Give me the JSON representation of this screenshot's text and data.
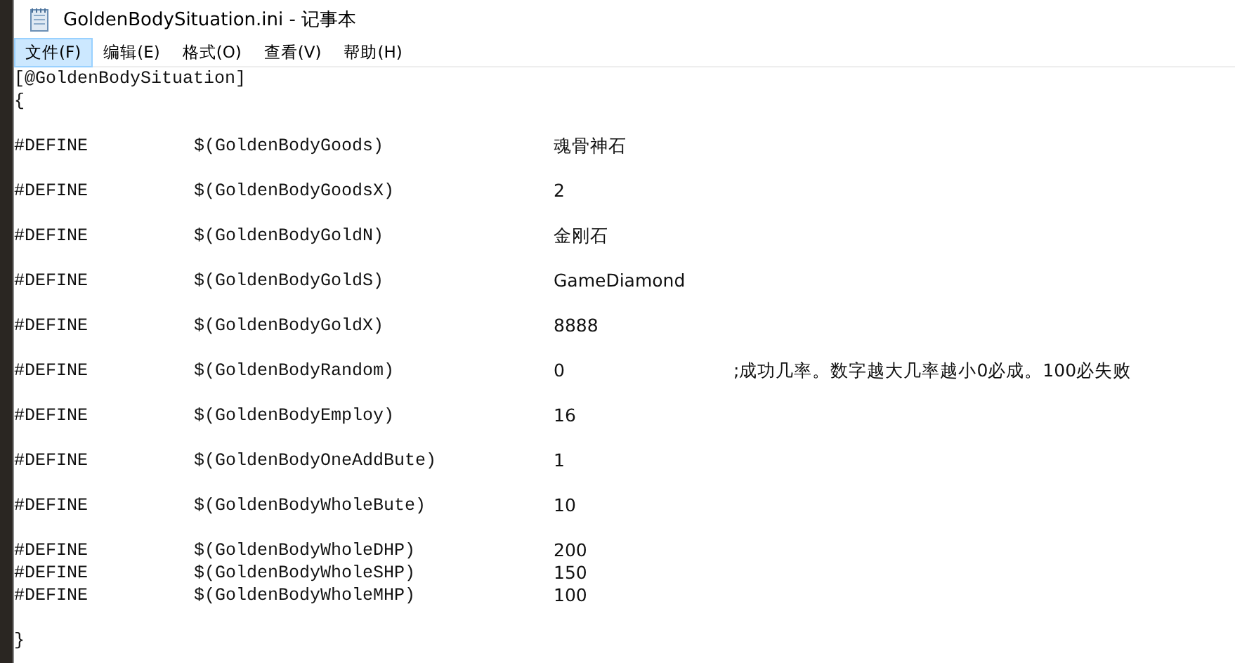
{
  "window": {
    "title": "GoldenBodySituation.ini - 记事本"
  },
  "menu": [
    {
      "label": "文件(F)",
      "selected": true
    },
    {
      "label": "编辑(E)",
      "selected": false
    },
    {
      "label": "格式(O)",
      "selected": false
    },
    {
      "label": "查看(V)",
      "selected": false
    },
    {
      "label": "帮助(H)",
      "selected": false
    }
  ],
  "lines": [
    {
      "kind": "text",
      "text": "[@GoldenBodySituation]"
    },
    {
      "kind": "text",
      "text": "{"
    },
    {
      "kind": "blank"
    },
    {
      "kind": "define",
      "keyword": "#DEFINE",
      "name": "$(GoldenBodyGoods)",
      "value": "魂骨神石"
    },
    {
      "kind": "blank"
    },
    {
      "kind": "define",
      "keyword": "#DEFINE",
      "name": "$(GoldenBodyGoodsX)",
      "value": "2"
    },
    {
      "kind": "blank"
    },
    {
      "kind": "define",
      "keyword": "#DEFINE",
      "name": "$(GoldenBodyGoldN)",
      "value": "金刚石"
    },
    {
      "kind": "blank"
    },
    {
      "kind": "define",
      "keyword": "#DEFINE",
      "name": "$(GoldenBodyGoldS)",
      "value": "GameDiamond"
    },
    {
      "kind": "blank"
    },
    {
      "kind": "define",
      "keyword": "#DEFINE",
      "name": "$(GoldenBodyGoldX)",
      "value": "8888"
    },
    {
      "kind": "blank"
    },
    {
      "kind": "define",
      "keyword": "#DEFINE",
      "name": "$(GoldenBodyRandom)",
      "value": "0",
      "comment": ";成功几率。数字越大几率越小0必成。100必失败"
    },
    {
      "kind": "blank"
    },
    {
      "kind": "define",
      "keyword": "#DEFINE",
      "name": "$(GoldenBodyEmploy)",
      "value": "16"
    },
    {
      "kind": "blank"
    },
    {
      "kind": "define",
      "keyword": "#DEFINE",
      "name": "$(GoldenBodyOneAddBute)",
      "value": "1"
    },
    {
      "kind": "blank"
    },
    {
      "kind": "define",
      "keyword": "#DEFINE",
      "name": "$(GoldenBodyWholeBute)",
      "value": "10"
    },
    {
      "kind": "blank"
    },
    {
      "kind": "define",
      "keyword": "#DEFINE",
      "name": "$(GoldenBodyWholeDHP)",
      "value": "200"
    },
    {
      "kind": "define",
      "keyword": "#DEFINE",
      "name": "$(GoldenBodyWholeSHP)",
      "value": "150"
    },
    {
      "kind": "define",
      "keyword": "#DEFINE",
      "name": "$(GoldenBodyWholeMHP)",
      "value": "100"
    },
    {
      "kind": "blank"
    },
    {
      "kind": "text",
      "text": "}"
    }
  ]
}
